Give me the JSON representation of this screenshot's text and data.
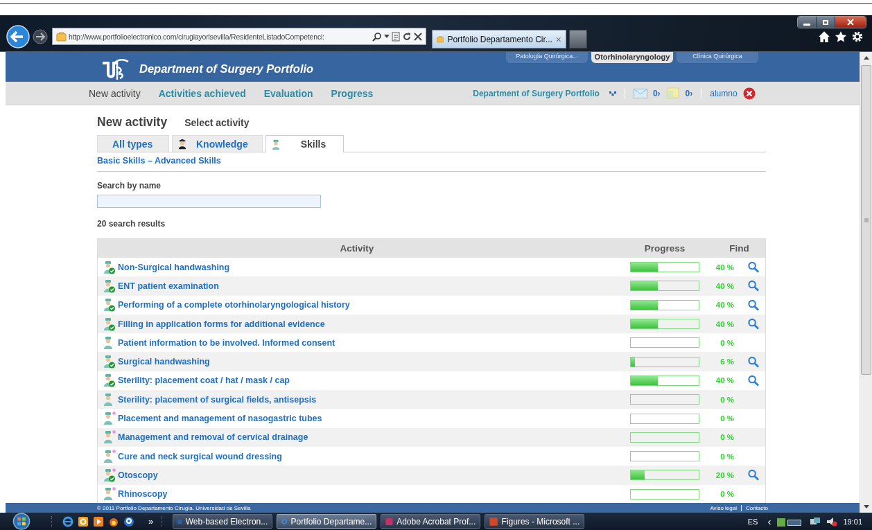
{
  "browser": {
    "url": "http://www.portfolioelectronico.com/cirugiayorlsevilla/ResidenteListadoCompetenci:",
    "tab_title": "Portfolio Departamento Cir...",
    "tab_close": "×"
  },
  "header": {
    "title": "Department of Surgery Portfolio",
    "subjects": [
      {
        "label": "Patología Quirúrgica...",
        "selected": false
      },
      {
        "label": "Otorhinolaryngology",
        "selected": true
      },
      {
        "label": "Clínica Quirúrgica",
        "selected": false
      }
    ]
  },
  "nav": {
    "items": [
      {
        "label": "New activity",
        "selected": true
      },
      {
        "label": "Activities achieved",
        "selected": false
      },
      {
        "label": "Evaluation",
        "selected": false
      },
      {
        "label": "Progress",
        "selected": false
      }
    ],
    "portfolio_link": "Department of Surgery Portfolio",
    "messages": "0›",
    "notes": "0›",
    "user": "alumno"
  },
  "page": {
    "title": "New activity",
    "subtitle": "Select activity",
    "tabs": [
      {
        "label": "All types",
        "selected": false
      },
      {
        "label": "Knowledge",
        "selected": false
      },
      {
        "label": "Skills",
        "selected": true
      }
    ],
    "filter_link": "Basic Skills – Advanced Skills",
    "search_label": "Search by name",
    "result_count": "20 search results"
  },
  "table": {
    "columns": [
      "Activity",
      "Progress",
      "Find"
    ],
    "rows": [
      {
        "name": "Non-Surgical handwashing",
        "achieved": true,
        "new": false,
        "level": 0.4,
        "percent": "40 %",
        "find": true
      },
      {
        "name": "ENT patient examination",
        "achieved": true,
        "new": false,
        "level": 0.4,
        "percent": "40 %",
        "find": true
      },
      {
        "name": "Performing of a complete otorhinolaryngological history",
        "achieved": true,
        "new": false,
        "level": 0.4,
        "percent": "40 %",
        "find": true
      },
      {
        "name": "Filling in application forms for additional evidence",
        "achieved": true,
        "new": false,
        "level": 0.4,
        "percent": "40 %",
        "find": true
      },
      {
        "name": "Patient information to be involved. Informed consent",
        "achieved": false,
        "new": false,
        "percent": "0 %",
        "find": false
      },
      {
        "name": "Surgical handwashing",
        "achieved": true,
        "new": false,
        "level": 0.06,
        "percent": "6 %",
        "find": true
      },
      {
        "name": "Sterility: placement coat / hat / mask / cap",
        "achieved": true,
        "new": false,
        "level": 0.4,
        "percent": "40 %",
        "find": true
      },
      {
        "name": "Sterility: placement of surgical fields, antisepsis",
        "achieved": false,
        "new": false,
        "percent": "0 %",
        "find": false
      },
      {
        "name": "Placement and management of nasogastric tubes",
        "achieved": false,
        "new": true,
        "percent": "0 %",
        "find": false
      },
      {
        "name": "Management and removal of cervical drainage",
        "achieved": false,
        "new": true,
        "percent": "0 %",
        "find": false
      },
      {
        "name": "Cure and neck surgical wound dressing",
        "achieved": false,
        "new": true,
        "percent": "0 %",
        "find": false
      },
      {
        "name": "Otoscopy",
        "achieved": true,
        "new": true,
        "level": 0.2,
        "percent": "20 %",
        "find": true
      },
      {
        "name": "Rhinoscopy",
        "achieved": false,
        "new": true,
        "percent": "0 %",
        "find": false
      }
    ]
  },
  "footer": {
    "copyright": "© 2011 Portfolio Departamento Cirugía. Universidad de Sevilla",
    "links": [
      "Aviso legal",
      "Contacto"
    ]
  },
  "taskbar": {
    "more": "»",
    "tasks": [
      {
        "label": "Web-based Electron...",
        "selected": false
      },
      {
        "label": "Portfolio Departame...",
        "selected": true
      },
      {
        "label": "Adobe Acrobat Prof...",
        "selected": false
      },
      {
        "label": "Figures - Microsoft ...",
        "selected": false
      }
    ],
    "language": "ES",
    "tray_arrow": "‹",
    "clock": "19:01"
  }
}
